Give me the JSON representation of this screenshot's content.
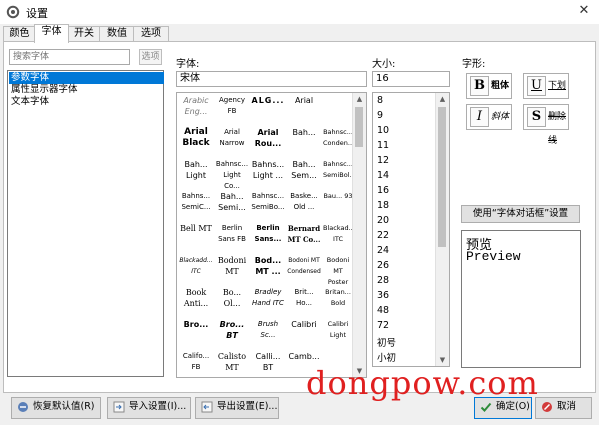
{
  "window": {
    "title": "设置",
    "close_glyph": "✕"
  },
  "tabs": [
    {
      "label": "颜色",
      "active": false
    },
    {
      "label": "字体",
      "active": true
    },
    {
      "label": "开关",
      "active": false
    },
    {
      "label": "数值",
      "active": false
    },
    {
      "label": "选项",
      "active": false
    }
  ],
  "left": {
    "search_placeholder": "搜索字体",
    "search_button": "选项",
    "items": [
      {
        "label": "参数字体",
        "selected": true
      },
      {
        "label": "属性显示器字体",
        "selected": false
      },
      {
        "label": "文本字体",
        "selected": false
      }
    ]
  },
  "font": {
    "label": "字体:",
    "value": "宋体",
    "samples": [
      [
        "Arabic Eng...",
        "Agency FB",
        "ALG...",
        "Arial"
      ],
      [
        "Arial Black",
        "Arial Narrow",
        "Arial Rou...",
        "Bah..."
      ],
      [
        "Bah... Light",
        "Bahnsc... Light Co...",
        "Bahns... Light ...",
        "Bah... Sem..."
      ],
      [
        "Bahns... SemiC...",
        "Bah... Semi...",
        "Bahnsc... SemiBo...",
        "Baske... Old ..."
      ],
      [
        "Bell MT",
        "Berlin Sans FB",
        "Berlin Sans...",
        "Bernard MT Co..."
      ],
      [
        "Blackadd... ITC",
        "Bodoni MT",
        "Bod... MT ...",
        "Bodoni MT Condensed"
      ],
      [
        "Book Anti...",
        "Bo... Ol...",
        "Bradley Hand ITC",
        "Brit... Ho..."
      ],
      [
        "Bro...",
        "Bro... BT",
        "Brush Sc...",
        "Calibri"
      ],
      [
        "Califo... FB",
        "Calisto MT",
        "Calli... BT",
        "Camb..."
      ]
    ],
    "samples_col5": [
      "",
      "Bahnsc... Conden...",
      "Bahnsc... SemiBol...",
      "Bau... 93",
      "Blackad... ITC",
      "Bodoni MT Poster C...",
      "Britan... Bold",
      "Calibri Light",
      ""
    ]
  },
  "size": {
    "label": "大小:",
    "value": "16",
    "options": [
      "8",
      "9",
      "10",
      "11",
      "12",
      "14",
      "16",
      "18",
      "20",
      "22",
      "24",
      "26",
      "28",
      "36",
      "48",
      "72",
      "初号",
      "小初"
    ]
  },
  "style": {
    "label": "字形:",
    "buttons": [
      {
        "glyph": "B",
        "label": "粗体"
      },
      {
        "glyph": "U",
        "label": "下划线"
      },
      {
        "glyph": "I",
        "label": "斜体"
      },
      {
        "glyph": "S",
        "label": "删除线"
      }
    ],
    "dialog_button": "使用“字体对话框”设置"
  },
  "preview": {
    "line1": "预览",
    "line2": "Preview"
  },
  "bottom": {
    "restore": "恢复默认值(R)",
    "import": "导入设置(I)...",
    "export": "导出设置(E)...",
    "ok": "确定(O)",
    "cancel": "取消"
  },
  "watermark": "dongpow.com",
  "colors": {
    "selection": "#0078d7",
    "watermark": "#e02020"
  }
}
